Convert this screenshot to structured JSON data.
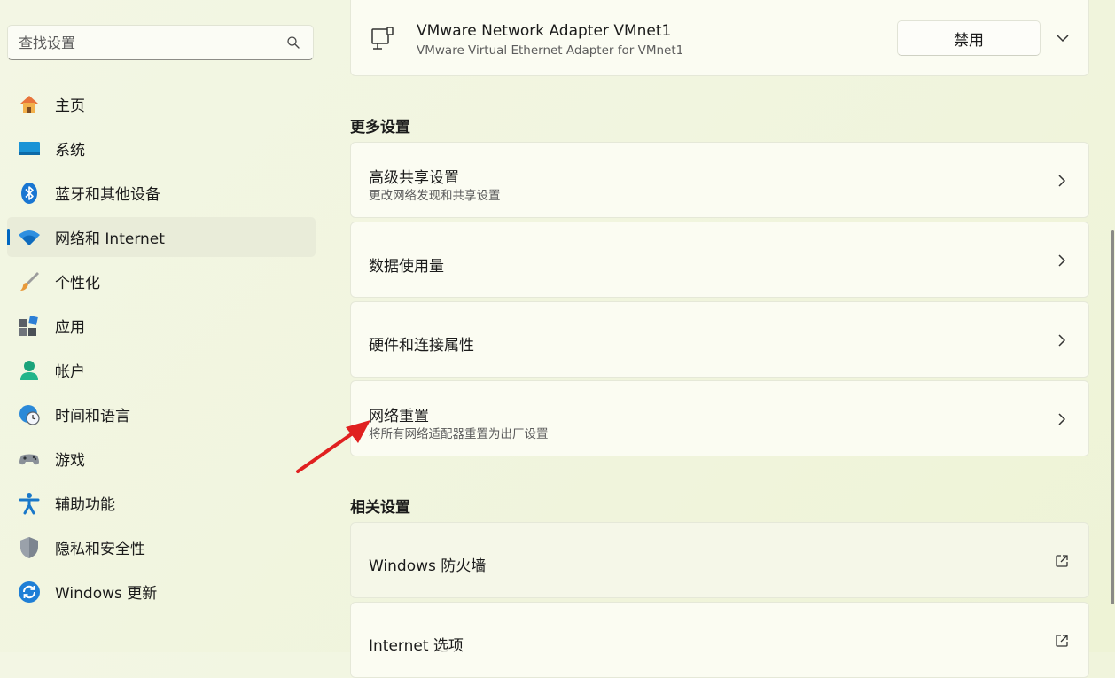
{
  "search": {
    "placeholder": "查找设置"
  },
  "sidebar": {
    "items": [
      {
        "label": "主页",
        "icon": "home-icon"
      },
      {
        "label": "系统",
        "icon": "system-icon"
      },
      {
        "label": "蓝牙和其他设备",
        "icon": "bluetooth-icon"
      },
      {
        "label": "网络和 Internet",
        "icon": "wifi-icon",
        "active": true
      },
      {
        "label": "个性化",
        "icon": "brush-icon"
      },
      {
        "label": "应用",
        "icon": "apps-icon"
      },
      {
        "label": "帐户",
        "icon": "account-icon"
      },
      {
        "label": "时间和语言",
        "icon": "globe-clock-icon"
      },
      {
        "label": "游戏",
        "icon": "gamepad-icon"
      },
      {
        "label": "辅助功能",
        "icon": "accessibility-icon"
      },
      {
        "label": "隐私和安全性",
        "icon": "shield-icon"
      },
      {
        "label": "Windows 更新",
        "icon": "update-icon"
      }
    ]
  },
  "adapter": {
    "name": "VMware Network Adapter VMnet1",
    "description": "VMware Virtual Ethernet Adapter for VMnet1",
    "disable_label": "禁用"
  },
  "more_settings": {
    "title": "更多设置",
    "items": [
      {
        "title": "高级共享设置",
        "subtitle": "更改网络发现和共享设置"
      },
      {
        "title": "数据使用量"
      },
      {
        "title": "硬件和连接属性"
      },
      {
        "title": "网络重置",
        "subtitle": "将所有网络适配器重置为出厂设置"
      }
    ]
  },
  "related_settings": {
    "title": "相关设置",
    "items": [
      {
        "title": "Windows 防火墙"
      },
      {
        "title": "Internet 选项"
      }
    ]
  },
  "colors": {
    "accent": "#0067c0",
    "annotation_arrow": "#e02020"
  }
}
